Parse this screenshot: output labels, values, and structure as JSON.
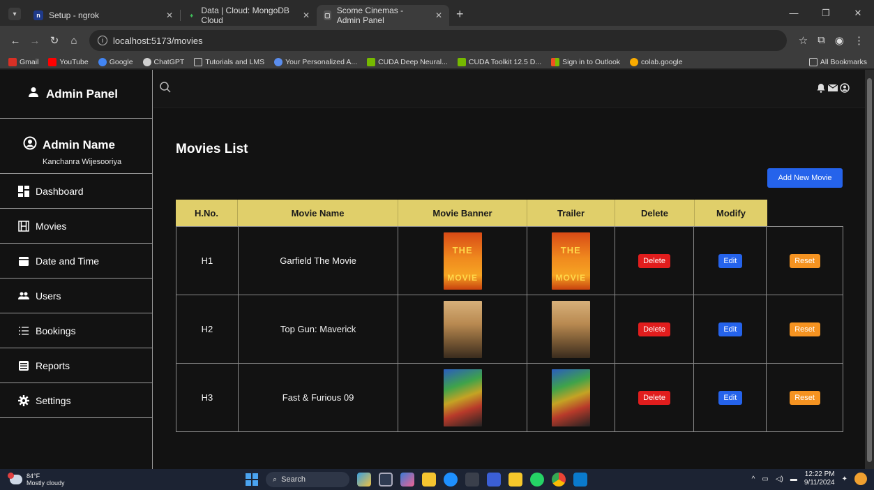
{
  "browser": {
    "tabs": [
      {
        "title": "Setup - ngrok",
        "icon": "ngrok-icon"
      },
      {
        "title": "Data | Cloud: MongoDB Cloud",
        "icon": "mongodb-icon"
      },
      {
        "title": "Scome Cinemas - Admin Panel",
        "icon": "page-icon"
      }
    ],
    "url": "localhost:5173/movies",
    "bookmarks": [
      "Gmail",
      "YouTube",
      "Google",
      "ChatGPT",
      "Tutorials and LMS",
      "Your Personalized A...",
      "CUDA Deep Neural...",
      "CUDA Toolkit 12.5 D...",
      "Sign in to Outlook",
      "colab.google"
    ],
    "all_bookmarks": "All Bookmarks"
  },
  "sidebar": {
    "brand": "Admin Panel",
    "admin_title": "Admin Name",
    "admin_name": "Kanchanra Wijesooriya",
    "items": [
      {
        "label": "Dashboard",
        "icon": "dashboard-icon"
      },
      {
        "label": "Movies",
        "icon": "film-icon"
      },
      {
        "label": "Date and Time",
        "icon": "calendar-icon"
      },
      {
        "label": "Users",
        "icon": "users-icon"
      },
      {
        "label": "Bookings",
        "icon": "list-icon"
      },
      {
        "label": "Reports",
        "icon": "reports-icon"
      },
      {
        "label": "Settings",
        "icon": "gear-icon"
      }
    ]
  },
  "main": {
    "title": "Movies List",
    "add_button": "Add New Movie",
    "columns": [
      "H.No.",
      "Movie Name",
      "Movie Banner",
      "Trailer",
      "Delete",
      "Modify"
    ],
    "rows": [
      {
        "hno": "H1",
        "name": "Garfield The Movie",
        "poster": "garfield"
      },
      {
        "hno": "H2",
        "name": "Top Gun: Maverick",
        "poster": "topgun"
      },
      {
        "hno": "H3",
        "name": "Fast & Furious 09",
        "poster": "fast"
      }
    ],
    "delete_label": "Delete",
    "edit_label": "Edit",
    "reset_label": "Reset",
    "poster_text_top": "THE",
    "poster_text_bottom": "MOVIE"
  },
  "taskbar": {
    "temp": "84°F",
    "weather": "Mostly cloudy",
    "search": "Search",
    "time": "12:22 PM",
    "date": "9/11/2024"
  }
}
